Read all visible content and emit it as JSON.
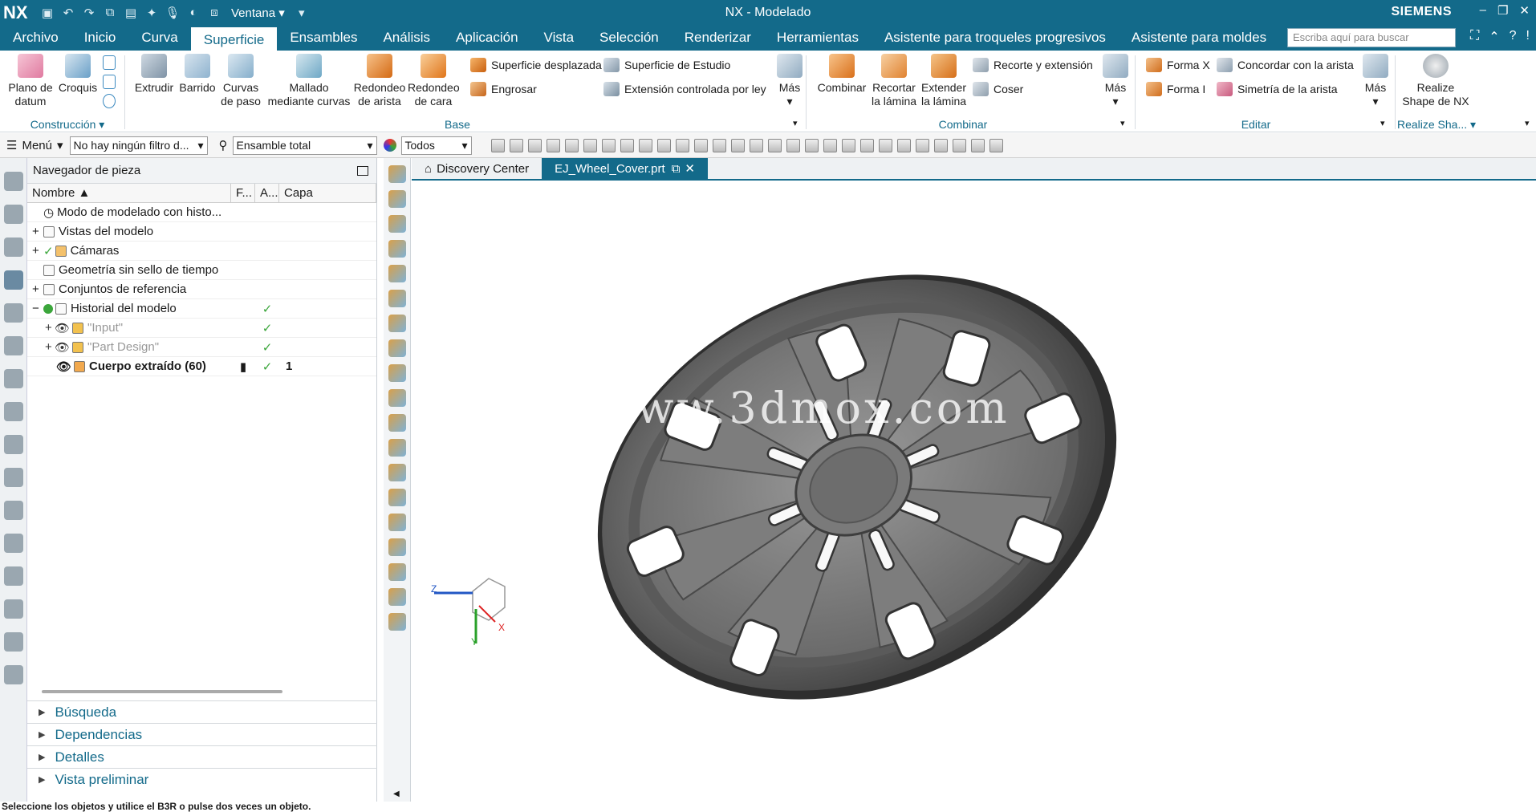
{
  "app": {
    "logo": "NX",
    "title": "NX - Modelado",
    "brand": "SIEMENS",
    "window_menu": "Ventana"
  },
  "menu": [
    "Archivo",
    "Inicio",
    "Curva",
    "Superficie",
    "Ensambles",
    "Análisis",
    "Aplicación",
    "Vista",
    "Selección",
    "Renderizar",
    "Herramientas",
    "Asistente para troqueles progresivos",
    "Asistente para moldes"
  ],
  "search": {
    "placeholder": "Escriba aquí para buscar"
  },
  "ribbon": {
    "construccion": {
      "label": "Construcción",
      "plano": "Plano de",
      "datum": "datum",
      "croquis": "Croquis"
    },
    "base": {
      "label": "Base",
      "extrudir": "Extrudir",
      "barrido": "Barrido",
      "curvas1": "Curvas",
      "curvas2": "de paso",
      "mallado1": "Mallado",
      "mallado2": "mediante curvas",
      "redarista1": "Redondeo",
      "redarista2": "de arista",
      "redcara1": "Redondeo",
      "redcara2": "de cara",
      "superficie_desplazada": "Superficie desplazada",
      "superficie_estudio": "Superficie de Estudio",
      "engrosar": "Engrosar",
      "extension": "Extensión controlada por ley",
      "mas": "Más"
    },
    "combinar": {
      "label": "Combinar",
      "combinar": "Combinar",
      "recortar1": "Recortar",
      "recortar2": "la lámina",
      "extender1": "Extender",
      "extender2": "la lámina",
      "recorte": "Recorte y extensión",
      "coser": "Coser",
      "mas": "Más"
    },
    "editar": {
      "label": "Editar",
      "formax": "Forma X",
      "formai": "Forma I",
      "concordar": "Concordar con la arista",
      "simetria": "Simetría de la arista",
      "mas": "Más"
    },
    "realize": {
      "label": "Realize Sha...",
      "b1": "Realize",
      "b2": "Shape de NX"
    }
  },
  "filterbar": {
    "menu": "Menú",
    "filter": "No hay ningún filtro d...",
    "scope": "Ensamble total",
    "todos": "Todos"
  },
  "navigator": {
    "title": "Navegador de pieza",
    "columns": [
      "Nombre",
      "F...",
      "A...",
      "Capa"
    ],
    "rows": [
      {
        "name": "Modo de modelado con histo...",
        "f": "",
        "a": "",
        "capa": ""
      },
      {
        "name": "Vistas del modelo",
        "f": "",
        "a": "",
        "capa": ""
      },
      {
        "name": "Cámaras",
        "f": "",
        "a": "",
        "capa": ""
      },
      {
        "name": "Geometría sin sello de tiempo",
        "f": "",
        "a": "",
        "capa": ""
      },
      {
        "name": "Conjuntos de referencia",
        "f": "",
        "a": "",
        "capa": ""
      },
      {
        "name": "Historial del modelo",
        "f": "",
        "a": "✓",
        "capa": ""
      },
      {
        "name": "\"Input\"",
        "f": "",
        "a": "✓",
        "capa": ""
      },
      {
        "name": "\"Part Design\"",
        "f": "",
        "a": "✓",
        "capa": ""
      },
      {
        "name": "Cuerpo extraído (60)",
        "f": "",
        "a": "✓",
        "capa": "1"
      }
    ],
    "panels": [
      "Búsqueda",
      "Dependencias",
      "Detalles",
      "Vista preliminar"
    ]
  },
  "tabs": {
    "discovery": "Discovery Center",
    "file": "EJ_Wheel_Cover.prt"
  },
  "viewport": {
    "watermark": "www.3dmox.com",
    "axis_z": "Z",
    "axis_x": "X",
    "axis_y": "Y"
  },
  "status": "Seleccione los objetos y utilice el B3R o pulse dos veces un objeto."
}
